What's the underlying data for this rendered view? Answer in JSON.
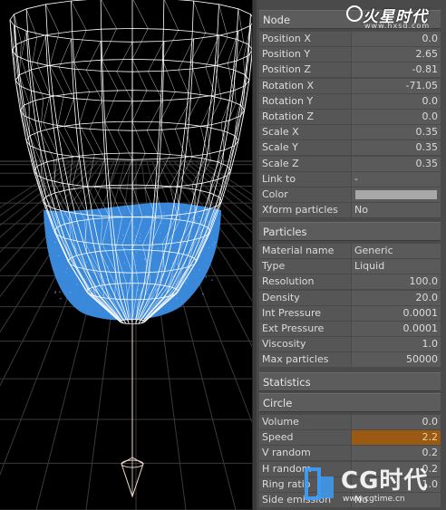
{
  "panel": {
    "node": {
      "header": "Node",
      "rows": [
        {
          "label": "Position X",
          "value": "0.0",
          "kind": "num"
        },
        {
          "label": "Position Y",
          "value": "2.65",
          "kind": "num"
        },
        {
          "label": "Position Z",
          "value": "-0.81",
          "kind": "num"
        },
        {
          "label": "Rotation X",
          "value": "-71.05",
          "kind": "num"
        },
        {
          "label": "Rotation Y",
          "value": "0.0",
          "kind": "num"
        },
        {
          "label": "Rotation Z",
          "value": "0.0",
          "kind": "num"
        },
        {
          "label": "Scale X",
          "value": "0.35",
          "kind": "num"
        },
        {
          "label": "Scale Y",
          "value": "0.35",
          "kind": "num"
        },
        {
          "label": "Scale Z",
          "value": "0.35",
          "kind": "num"
        },
        {
          "label": "Link to",
          "value": "-",
          "kind": "txt"
        },
        {
          "label": "Color",
          "value": "",
          "kind": "color"
        },
        {
          "label": "Xform particles",
          "value": "No",
          "kind": "txt"
        }
      ]
    },
    "particles": {
      "header": "Particles",
      "rows": [
        {
          "label": "Material name",
          "value": "Generic",
          "kind": "txt"
        },
        {
          "label": "Type",
          "value": "Liquid",
          "kind": "txt"
        },
        {
          "label": "Resolution",
          "value": "100.0",
          "kind": "num"
        },
        {
          "label": "Density",
          "value": "20.0",
          "kind": "num"
        },
        {
          "label": "Int Pressure",
          "value": "0.0001",
          "kind": "num"
        },
        {
          "label": "Ext Pressure",
          "value": "0.0001",
          "kind": "num"
        },
        {
          "label": "Viscosity",
          "value": "1.0",
          "kind": "num"
        },
        {
          "label": "Max particles",
          "value": "50000",
          "kind": "num"
        }
      ]
    },
    "statistics": {
      "header": "Statistics"
    },
    "circle": {
      "header": "Circle",
      "rows": [
        {
          "label": "Volume",
          "value": "0.0",
          "kind": "num"
        },
        {
          "label": "Speed",
          "value": "2.2",
          "kind": "num",
          "highlight": true
        },
        {
          "label": "V random",
          "value": "0.2",
          "kind": "num"
        },
        {
          "label": "H random",
          "value": "0.2",
          "kind": "num"
        },
        {
          "label": "Ring ratio",
          "value": "1.0",
          "kind": "num"
        },
        {
          "label": "Side emission",
          "value": "No",
          "kind": "txt"
        }
      ]
    }
  },
  "colors": {
    "panel_bg": "#4a4a4a",
    "fluid": "#3d8fe6",
    "wire": "#ffffff",
    "speed_highlight": "#9a5a14",
    "color_swatch": "#a8a8a8"
  },
  "logos": {
    "top_brand": "火星时代",
    "top_url": "www.hxsd.com",
    "bottom_brand": "CG时代",
    "bottom_url": "www.cgtime.cn"
  }
}
